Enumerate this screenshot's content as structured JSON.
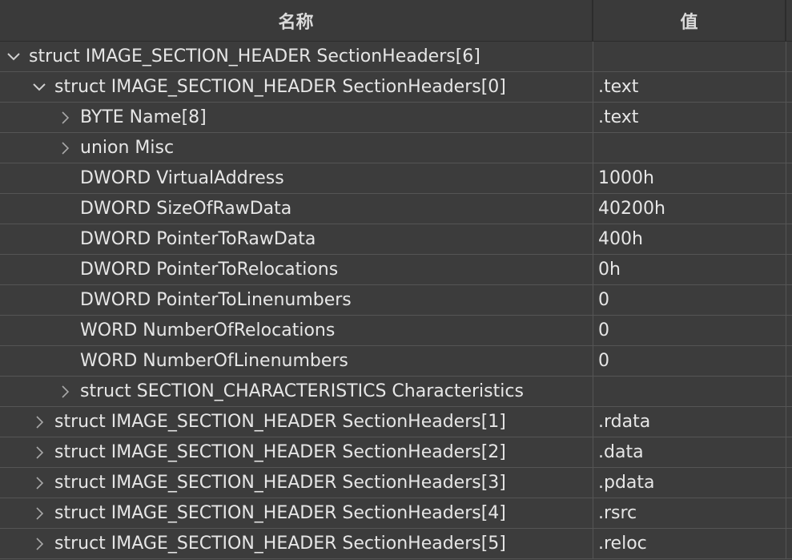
{
  "header": {
    "name_col": "名称",
    "value_col": "值"
  },
  "rows": [
    {
      "label": "struct IMAGE_SECTION_HEADER SectionHeaders[6]",
      "value": "",
      "state": "expanded"
    },
    {
      "label": "struct IMAGE_SECTION_HEADER SectionHeaders[0]",
      "value": ".text",
      "state": "expanded"
    },
    {
      "label": "BYTE Name[8]",
      "value": ".text",
      "state": "collapsed"
    },
    {
      "label": "union Misc",
      "value": "",
      "state": "collapsed"
    },
    {
      "label": "DWORD VirtualAddress",
      "value": "1000h",
      "state": "leaf"
    },
    {
      "label": "DWORD SizeOfRawData",
      "value": "40200h",
      "state": "leaf"
    },
    {
      "label": "DWORD PointerToRawData",
      "value": "400h",
      "state": "leaf"
    },
    {
      "label": "DWORD PointerToRelocations",
      "value": "0h",
      "state": "leaf"
    },
    {
      "label": "DWORD PointerToLinenumbers",
      "value": "0",
      "state": "leaf"
    },
    {
      "label": "WORD NumberOfRelocations",
      "value": "0",
      "state": "leaf"
    },
    {
      "label": "WORD NumberOfLinenumbers",
      "value": "0",
      "state": "leaf"
    },
    {
      "label": "struct SECTION_CHARACTERISTICS Characteristics",
      "value": "",
      "state": "collapsed"
    },
    {
      "label": "struct IMAGE_SECTION_HEADER SectionHeaders[1]",
      "value": ".rdata",
      "state": "collapsed"
    },
    {
      "label": "struct IMAGE_SECTION_HEADER SectionHeaders[2]",
      "value": ".data",
      "state": "collapsed"
    },
    {
      "label": "struct IMAGE_SECTION_HEADER SectionHeaders[3]",
      "value": ".pdata",
      "state": "collapsed"
    },
    {
      "label": "struct IMAGE_SECTION_HEADER SectionHeaders[4]",
      "value": ".rsrc",
      "state": "collapsed"
    },
    {
      "label": "struct IMAGE_SECTION_HEADER SectionHeaders[5]",
      "value": ".reloc",
      "state": "collapsed"
    }
  ],
  "icons": {
    "expanded": "chevron-down-icon",
    "collapsed": "chevron-right-icon"
  },
  "colors": {
    "background": "#3c3c3c",
    "text": "#e6e6e6",
    "grid": "#555555"
  }
}
